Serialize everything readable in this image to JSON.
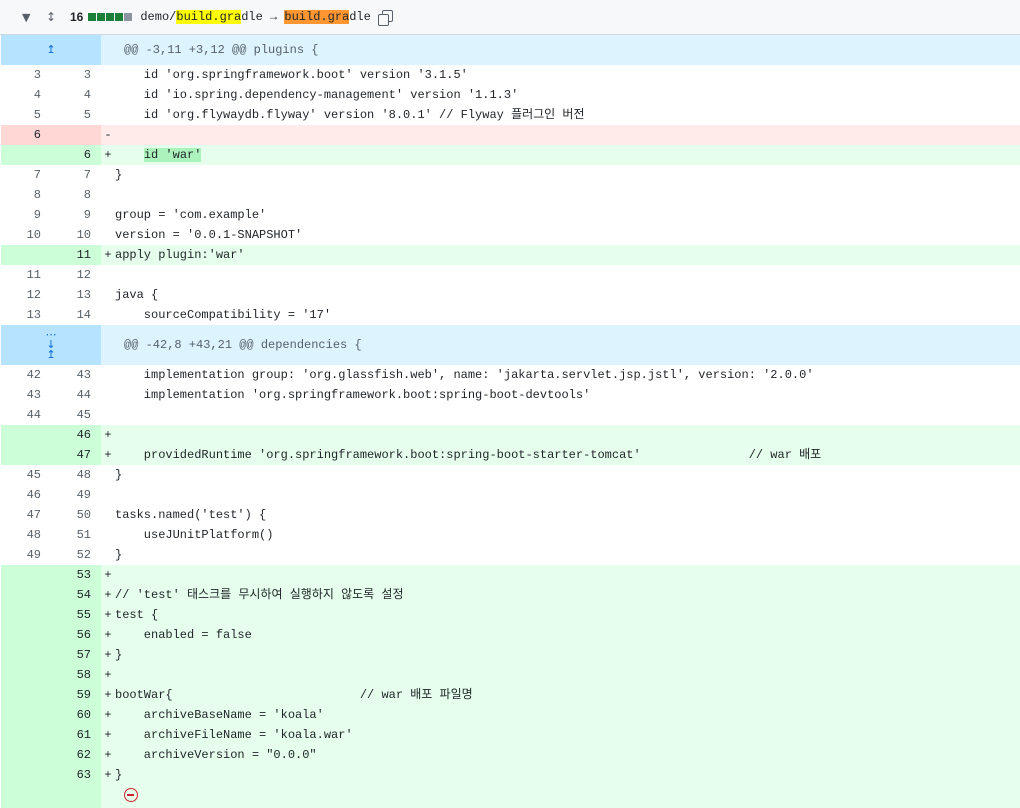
{
  "file_header": {
    "collapse_icon": "chevron-down-icon",
    "expand_icon": "unfold-icon",
    "changes_count": "16",
    "diffstat_colors": [
      "#1a7f37",
      "#1a7f37",
      "#1a7f37",
      "#1a7f37",
      "#8c959f"
    ],
    "path_prefix": "demo/",
    "old_name_hl": "build.gra",
    "old_name_rest": "dle",
    "arrow": " → ",
    "new_name_hl": "build.gra",
    "new_name_rest": "dle",
    "copy_icon": "copy-icon"
  },
  "hunks": [
    {
      "header": "@@ -3,11 +3,12 @@ plugins {",
      "icon": "expand-up-icon"
    },
    {
      "header": "@@ -42,8 +43,21 @@ dependencies {",
      "icon": "expand-both-icon"
    }
  ],
  "lines1": [
    {
      "old": "3",
      "new": "3",
      "sign": " ",
      "t1": "    id 'org.springframework.boot' version '3.1.5'"
    },
    {
      "old": "4",
      "new": "4",
      "sign": " ",
      "t1": "    id 'io.spring.dependency-management' version '1.1.3'"
    },
    {
      "old": "5",
      "new": "5",
      "sign": " ",
      "t1": "    id 'org.flywaydb.flyway' version '8.0.1' // Flyway 플러그인 버전"
    },
    {
      "old": "6",
      "new": "",
      "sign": "-",
      "t1": ""
    },
    {
      "old": "",
      "new": "6",
      "sign": "+",
      "t1": "    ",
      "t2": "id 'war'"
    },
    {
      "old": "7",
      "new": "7",
      "sign": " ",
      "t1": "}"
    },
    {
      "old": "8",
      "new": "8",
      "sign": " ",
      "t1": ""
    },
    {
      "old": "9",
      "new": "9",
      "sign": " ",
      "t1": "group = 'com.example'"
    },
    {
      "old": "10",
      "new": "10",
      "sign": " ",
      "t1": "version = '0.0.1-SNAPSHOT'"
    },
    {
      "old": "",
      "new": "11",
      "sign": "+",
      "t1": "apply plugin:'war'"
    },
    {
      "old": "11",
      "new": "12",
      "sign": " ",
      "t1": ""
    },
    {
      "old": "12",
      "new": "13",
      "sign": " ",
      "t1": "java {"
    },
    {
      "old": "13",
      "new": "14",
      "sign": " ",
      "t1": "    sourceCompatibility = '17'"
    }
  ],
  "lines2": [
    {
      "old": "42",
      "new": "43",
      "sign": " ",
      "t1": "    implementation group: 'org.glassfish.web', name: 'jakarta.servlet.jsp.jstl', version: '2.0.0'"
    },
    {
      "old": "43",
      "new": "44",
      "sign": " ",
      "t1": "    implementation 'org.springframework.boot:spring-boot-devtools'"
    },
    {
      "old": "44",
      "new": "45",
      "sign": " ",
      "t1": ""
    },
    {
      "old": "",
      "new": "46",
      "sign": "+",
      "t1": ""
    },
    {
      "old": "",
      "new": "47",
      "sign": "+",
      "t1": "    providedRuntime 'org.springframework.boot:spring-boot-starter-tomcat'               // war 배포"
    },
    {
      "old": "45",
      "new": "48",
      "sign": " ",
      "t1": "}"
    },
    {
      "old": "46",
      "new": "49",
      "sign": " ",
      "t1": ""
    },
    {
      "old": "47",
      "new": "50",
      "sign": " ",
      "t1": "tasks.named('test') {"
    },
    {
      "old": "48",
      "new": "51",
      "sign": " ",
      "t1": "    useJUnitPlatform()"
    },
    {
      "old": "49",
      "new": "52",
      "sign": " ",
      "t1": "}"
    },
    {
      "old": "",
      "new": "53",
      "sign": "+",
      "t1": ""
    },
    {
      "old": "",
      "new": "54",
      "sign": "+",
      "t1": "// 'test' 태스크를 무시하여 실행하지 않도록 설정"
    },
    {
      "old": "",
      "new": "55",
      "sign": "+",
      "t1": "test {"
    },
    {
      "old": "",
      "new": "56",
      "sign": "+",
      "t1": "    enabled = false"
    },
    {
      "old": "",
      "new": "57",
      "sign": "+",
      "t1": "}"
    },
    {
      "old": "",
      "new": "58",
      "sign": "+",
      "t1": ""
    },
    {
      "old": "",
      "new": "59",
      "sign": "+",
      "t1": "bootWar{                          // war 배포 파일명"
    },
    {
      "old": "",
      "new": "60",
      "sign": "+",
      "t1": "    archiveBaseName = 'koala'"
    },
    {
      "old": "",
      "new": "61",
      "sign": "+",
      "t1": "    archiveFileName = 'koala.war'"
    },
    {
      "old": "",
      "new": "62",
      "sign": "+",
      "t1": "    archiveVersion = \"0.0.0\""
    },
    {
      "old": "",
      "new": "63",
      "sign": "+",
      "t1": "}"
    }
  ],
  "no_newline_icon": "no-entry-icon"
}
